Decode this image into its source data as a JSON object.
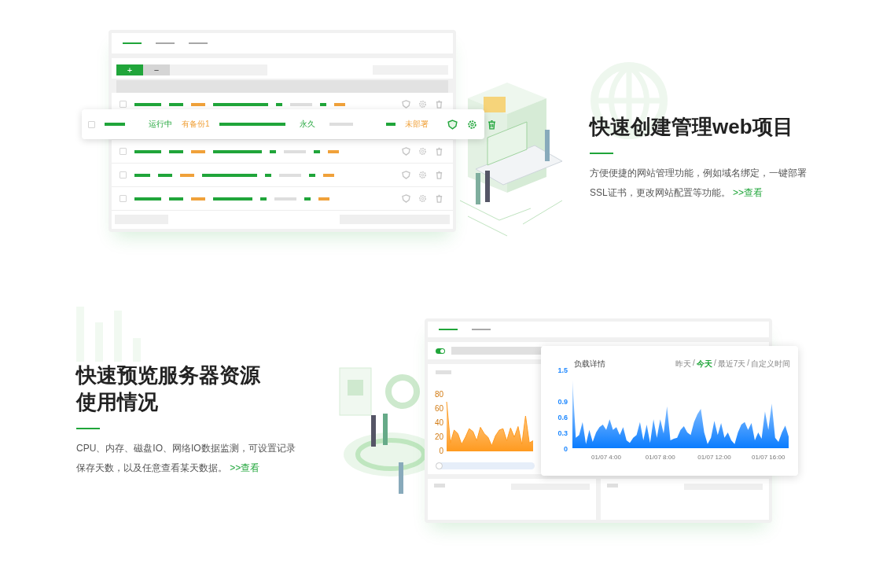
{
  "website_feature": {
    "mockup": {
      "tabs": [
        {
          "selected": true
        },
        {
          "selected": false
        },
        {
          "selected": false
        }
      ],
      "toolbar": {
        "add": "+",
        "remove": "−"
      },
      "rows": [
        {
          "checked": false
        },
        {
          "checked": false
        },
        {
          "checked": false
        },
        {
          "checked": false
        }
      ],
      "highlighted_row": {
        "checked": false,
        "status": "运行中",
        "backup": "有备份1",
        "expiry": "永久",
        "ssl": "未部署"
      }
    },
    "title": "快速创建管理web项目",
    "description": "方便便捷的网站管理功能，例如域名绑定，一键部署SSL证书，更改网站配置等功能。",
    "link": ">>查看"
  },
  "monitor_feature": {
    "title": "快速预览服务器资源使用情况",
    "description": "CPU、内存、磁盘IO、网络IO数据监测，可设置记录保存天数，以及任意查看某天数据。",
    "link": ">>查看",
    "mockup": {
      "tabs": [
        {
          "selected": true
        },
        {
          "selected": false
        }
      ],
      "toggle": {
        "on": true
      },
      "slider": {
        "level": 0
      },
      "cpu_chart": {
        "chart_data": {
          "type": "area",
          "ylim": [
            0,
            80
          ],
          "yticks": [
            0,
            20,
            40,
            60,
            80
          ],
          "categories": [
            null,
            null,
            null,
            null,
            null,
            null,
            null,
            null,
            null,
            null,
            null,
            null,
            null,
            null,
            null,
            null,
            null,
            null,
            null,
            null,
            null,
            null,
            null,
            null
          ],
          "series": [
            {
              "color": "#ff9a1f",
              "values": [
                70,
                12,
                30,
                25,
                10,
                20,
                32,
                28,
                15,
                34,
                25,
                20,
                8,
                22,
                30,
                32,
                15,
                33,
                20,
                35,
                10,
                50,
                12,
                15
              ]
            }
          ]
        }
      },
      "load_card": {
        "title": "负载详情",
        "separator": "/",
        "ranges": [
          {
            "label": "昨天",
            "selected": false
          },
          {
            "label": "今天",
            "selected": true
          },
          {
            "label": "最近7天",
            "selected": false
          },
          {
            "label": "自定义时间",
            "selected": false
          }
        ],
        "chart_data": {
          "type": "area",
          "ylim": [
            0,
            1.5
          ],
          "yticks": [
            0,
            0.3,
            0.6,
            0.9,
            1.5
          ],
          "categories": [
            null,
            null,
            null,
            null,
            null,
            null,
            null,
            null,
            null,
            null,
            "01/07 4:00",
            null,
            null,
            null,
            null,
            null,
            null,
            null,
            null,
            null,
            null,
            null,
            null,
            null,
            null,
            null,
            "01/07 8:00",
            null,
            null,
            null,
            null,
            null,
            null,
            null,
            null,
            null,
            null,
            null,
            null,
            null,
            null,
            null,
            "01/07 12:00",
            null,
            null,
            null,
            null,
            null,
            null,
            null,
            null,
            null,
            null,
            null,
            null,
            null,
            null,
            null,
            "01/07 16:00",
            null,
            null,
            null,
            null,
            null,
            null
          ],
          "values": [
            1.3,
            0.2,
            0.25,
            0.5,
            0.08,
            0.35,
            0.12,
            0.3,
            0.4,
            0.45,
            0.35,
            0.55,
            0.35,
            0.4,
            0.25,
            0.4,
            0.15,
            0.1,
            0.2,
            0.25,
            0.5,
            0.15,
            0.45,
            0.1,
            0.55,
            0.2,
            0.55,
            0.28,
            0.8,
            0.15,
            0.18,
            0.2,
            0.35,
            0.42,
            0.3,
            0.25,
            0.5,
            0.65,
            0.75,
            0.3,
            0.08,
            0.2,
            0.52,
            0.25,
            0.48,
            0.2,
            0.3,
            0.15,
            0.08,
            0.3,
            0.45,
            0.5,
            0.35,
            0.48,
            0.15,
            0.3,
            0.18,
            0.7,
            0.35,
            0.85,
            0.2,
            0.12,
            0.3,
            0.43,
            0.22
          ]
        }
      }
    }
  }
}
